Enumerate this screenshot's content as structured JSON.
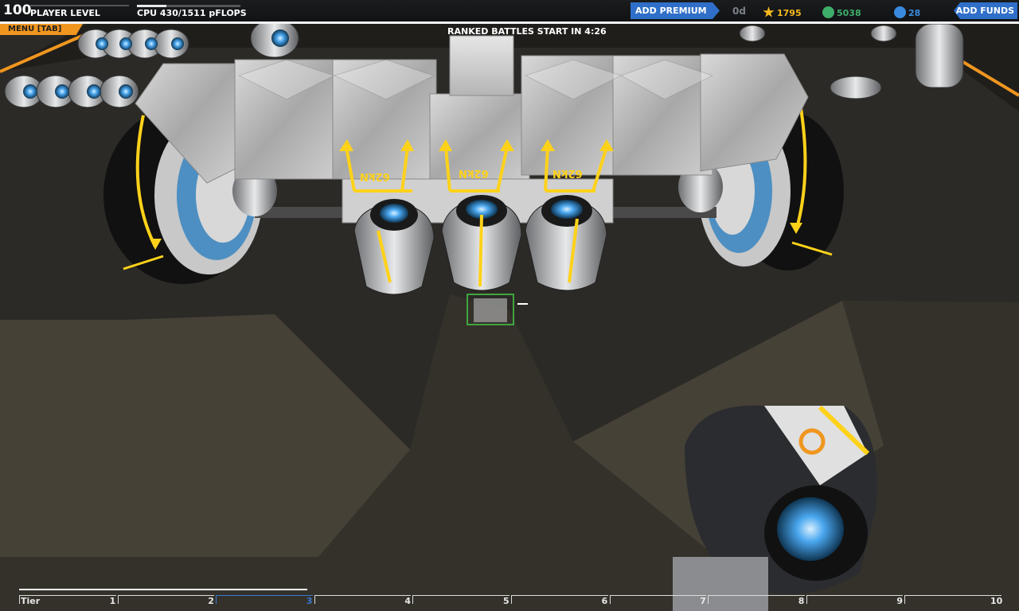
{
  "hud": {
    "player_level": "100",
    "player_level_label": "PLAYER LEVEL",
    "cpu_label": "CPU 430/1511 pFLOPS",
    "cpu_fraction": 0.285,
    "add_premium": "ADD PREMIUM",
    "premium_days": "0d",
    "robits": "1795",
    "rp": "5038",
    "gc": "28",
    "add_funds": "ADD FUNDS",
    "menu": "MENU [TAB]",
    "ranked_text": "RANKED BATTLES START IN  4:26"
  },
  "thrusters": {
    "force_label": "62kN"
  },
  "tier": {
    "label": "Tier",
    "numbers": [
      "1",
      "2",
      "3",
      "4",
      "5",
      "6",
      "7",
      "8",
      "9",
      "10"
    ],
    "current": "3"
  },
  "colors": {
    "premium_blue": "#2f6fc9",
    "menu_orange": "#f0961f",
    "arrow_yellow": "#ffd21a",
    "robits_gold": "#f6b91e",
    "rp_green": "#3fae6a",
    "gc_blue": "#3a8be0"
  },
  "icons": [
    "star-icon",
    "rp-icon",
    "gc-icon",
    "arrow-icon",
    "thruster-icon",
    "wheel-icon",
    "cube-icon",
    "crosshair-icon"
  ]
}
